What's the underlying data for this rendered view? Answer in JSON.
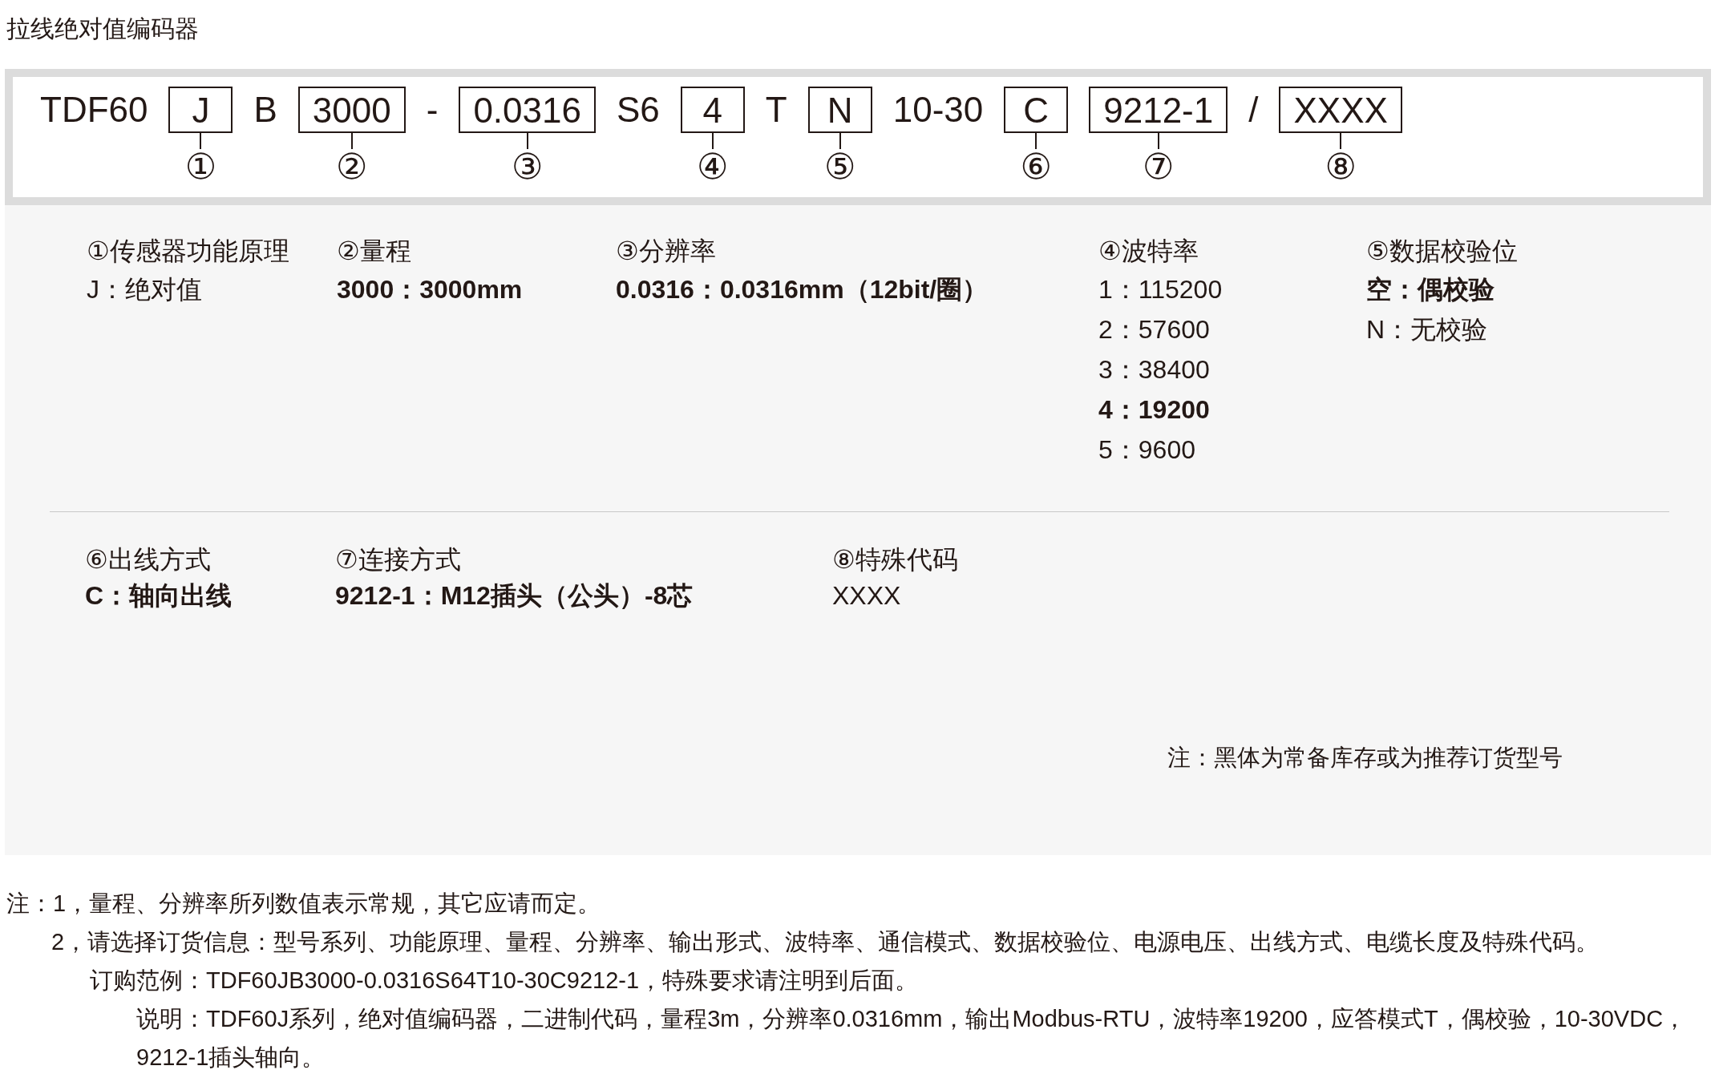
{
  "title": "拉线绝对值编码器",
  "code": [
    {
      "kind": "text",
      "text": "TDF60"
    },
    {
      "kind": "box",
      "text": "J",
      "marker": "①"
    },
    {
      "kind": "text",
      "text": "B"
    },
    {
      "kind": "box",
      "text": "3000",
      "marker": "②"
    },
    {
      "kind": "text",
      "text": "-"
    },
    {
      "kind": "box",
      "text": "0.0316",
      "marker": "③"
    },
    {
      "kind": "text",
      "text": "S6"
    },
    {
      "kind": "box",
      "text": "4",
      "marker": "④"
    },
    {
      "kind": "text",
      "text": "T"
    },
    {
      "kind": "box",
      "text": "N",
      "marker": "⑤"
    },
    {
      "kind": "text",
      "text": "10-30"
    },
    {
      "kind": "box",
      "text": "C",
      "marker": "⑥"
    },
    {
      "kind": "box",
      "text": "9212-1",
      "marker": "⑦"
    },
    {
      "kind": "text",
      "text": "/"
    },
    {
      "kind": "box",
      "text": "XXXX",
      "marker": "⑧"
    }
  ],
  "sections_row_1": [
    {
      "heading": "①传感器功能原理",
      "options": [
        {
          "text": "J：绝对值",
          "bold": false
        }
      ]
    },
    {
      "heading": "②量程",
      "options": [
        {
          "text": "3000：3000mm",
          "bold": true
        }
      ]
    },
    {
      "heading": "③分辨率",
      "options": [
        {
          "text": "0.0316：0.0316mm（12bit/圈）",
          "bold": true
        }
      ]
    },
    {
      "heading": "④波特率",
      "options": [
        {
          "text": "1：115200",
          "bold": false
        },
        {
          "text": "2：57600",
          "bold": false
        },
        {
          "text": "3：38400",
          "bold": false
        },
        {
          "text": "4：19200",
          "bold": true
        },
        {
          "text": "5：9600",
          "bold": false
        }
      ]
    },
    {
      "heading": "⑤数据校验位",
      "options": [
        {
          "text": "空：偶校验",
          "bold": true
        },
        {
          "text": "N：无校验",
          "bold": false
        }
      ]
    }
  ],
  "sections_row_2": [
    {
      "heading": "⑥出线方式",
      "options": [
        {
          "text": "C：轴向出线",
          "bold": true
        }
      ]
    },
    {
      "heading": "⑦连接方式",
      "options": [
        {
          "text": "9212-1：M12插头（公头）-8芯",
          "bold": true
        }
      ]
    },
    {
      "heading": "⑧特殊代码",
      "options": [
        {
          "text": "XXXX",
          "bold": false
        }
      ]
    }
  ],
  "panel_note": "注：黑体为常备库存或为推荐订货型号",
  "notes": [
    "注：1，量程、分辨率所列数值表示常规，其它应请而定。",
    "2，请选择订货信息：型号系列、功能原理、量程、分辨率、输出形式、波特率、通信模式、数据校验位、电源电压、出线方式、电缆长度及特殊代码。",
    "订购范例：TDF60JB3000-0.0316S64T10-30C9212-1，特殊要求请注明到后面。",
    "说明：TDF60J系列，绝对值编码器，二进制代码，量程3m，分辨率0.0316mm，输出Modbus-RTU，波特率19200，应答模式T，偶校验，10-30VDC，",
    "9212-1插头轴向。"
  ]
}
